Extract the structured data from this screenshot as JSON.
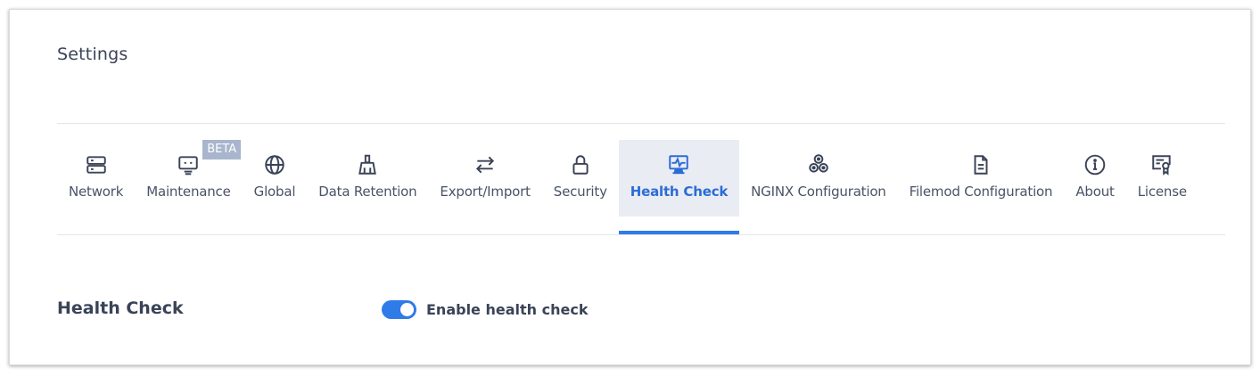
{
  "page": {
    "title": "Settings"
  },
  "tabs": [
    {
      "label": "Network",
      "icon": "server-icon"
    },
    {
      "label": "Maintenance",
      "icon": "monitor-settings-icon",
      "badge": "BETA"
    },
    {
      "label": "Global",
      "icon": "globe-icon"
    },
    {
      "label": "Data Retention",
      "icon": "broom-icon"
    },
    {
      "label": "Export/Import",
      "icon": "arrows-exchange-icon"
    },
    {
      "label": "Security",
      "icon": "lock-icon"
    },
    {
      "label": "Health Check",
      "icon": "monitor-pulse-icon",
      "active": true
    },
    {
      "label": "NGINX Configuration",
      "icon": "hexagons-icon"
    },
    {
      "label": "Filemod Configuration",
      "icon": "document-icon"
    },
    {
      "label": "About",
      "icon": "info-icon"
    },
    {
      "label": "License",
      "icon": "certificate-icon"
    }
  ],
  "section": {
    "title": "Health Check",
    "toggle": {
      "label": "Enable health check",
      "enabled": true
    }
  },
  "colors": {
    "accent": "#2f7be8",
    "active_tab_bg": "#e9ecf3",
    "beta_badge": "#a8b5cc"
  }
}
